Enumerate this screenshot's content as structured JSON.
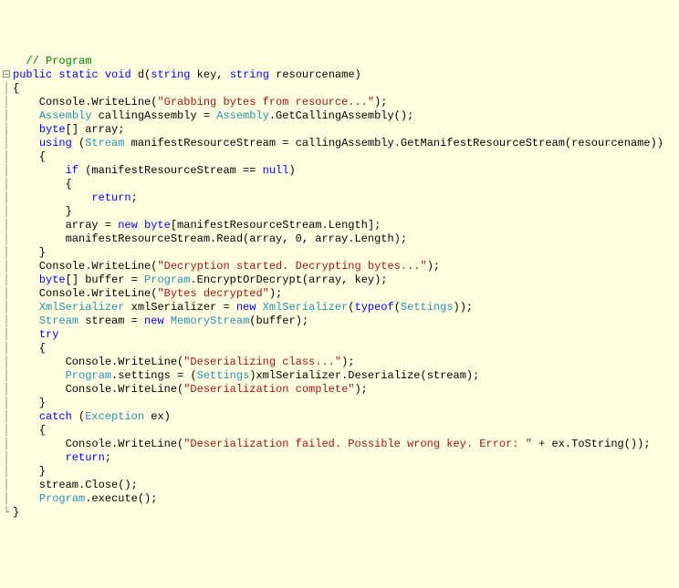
{
  "lines": [
    {
      "gutter": "",
      "tokens": [
        {
          "cls": "c-ident",
          "t": "  "
        },
        {
          "cls": "c-comment",
          "t": "// Program"
        }
      ]
    },
    {
      "gutter": "⊟",
      "tokens": [
        {
          "cls": "c-keyword",
          "t": "public"
        },
        {
          "cls": "c-ident",
          "t": " "
        },
        {
          "cls": "c-keyword",
          "t": "static"
        },
        {
          "cls": "c-ident",
          "t": " "
        },
        {
          "cls": "c-keyword",
          "t": "void"
        },
        {
          "cls": "c-ident",
          "t": " d("
        },
        {
          "cls": "c-keyword",
          "t": "string"
        },
        {
          "cls": "c-ident",
          "t": " key, "
        },
        {
          "cls": "c-keyword",
          "t": "string"
        },
        {
          "cls": "c-ident",
          "t": " resourcename)"
        }
      ]
    },
    {
      "gutter": "│",
      "tokens": [
        {
          "cls": "c-ident",
          "t": "{"
        }
      ]
    },
    {
      "gutter": "│",
      "tokens": [
        {
          "cls": "c-ident",
          "t": "    Console.WriteLine("
        },
        {
          "cls": "c-string",
          "t": "\"Grabbing bytes from resource...\""
        },
        {
          "cls": "c-ident",
          "t": ");"
        }
      ]
    },
    {
      "gutter": "│",
      "tokens": [
        {
          "cls": "c-ident",
          "t": "    "
        },
        {
          "cls": "c-type",
          "t": "Assembly"
        },
        {
          "cls": "c-ident",
          "t": " callingAssembly = "
        },
        {
          "cls": "c-type",
          "t": "Assembly"
        },
        {
          "cls": "c-ident",
          "t": ".GetCallingAssembly();"
        }
      ]
    },
    {
      "gutter": "│",
      "tokens": [
        {
          "cls": "c-ident",
          "t": "    "
        },
        {
          "cls": "c-keyword",
          "t": "byte"
        },
        {
          "cls": "c-ident",
          "t": "[] array;"
        }
      ]
    },
    {
      "gutter": "│",
      "tokens": [
        {
          "cls": "c-ident",
          "t": "    "
        },
        {
          "cls": "c-keyword",
          "t": "using"
        },
        {
          "cls": "c-ident",
          "t": " ("
        },
        {
          "cls": "c-type",
          "t": "Stream"
        },
        {
          "cls": "c-ident",
          "t": " manifestResourceStream = callingAssembly.GetManifestResourceStream(resourcename))"
        }
      ]
    },
    {
      "gutter": "│",
      "tokens": [
        {
          "cls": "c-ident",
          "t": "    {"
        }
      ]
    },
    {
      "gutter": "│",
      "tokens": [
        {
          "cls": "c-ident",
          "t": "        "
        },
        {
          "cls": "c-keyword",
          "t": "if"
        },
        {
          "cls": "c-ident",
          "t": " (manifestResourceStream == "
        },
        {
          "cls": "c-keyword",
          "t": "null"
        },
        {
          "cls": "c-ident",
          "t": ")"
        }
      ]
    },
    {
      "gutter": "│",
      "tokens": [
        {
          "cls": "c-ident",
          "t": "        {"
        }
      ]
    },
    {
      "gutter": "│",
      "tokens": [
        {
          "cls": "c-ident",
          "t": "            "
        },
        {
          "cls": "c-keyword",
          "t": "return"
        },
        {
          "cls": "c-ident",
          "t": ";"
        }
      ]
    },
    {
      "gutter": "│",
      "tokens": [
        {
          "cls": "c-ident",
          "t": "        }"
        }
      ]
    },
    {
      "gutter": "│",
      "tokens": [
        {
          "cls": "c-ident",
          "t": "        array = "
        },
        {
          "cls": "c-keyword",
          "t": "new"
        },
        {
          "cls": "c-ident",
          "t": " "
        },
        {
          "cls": "c-keyword",
          "t": "byte"
        },
        {
          "cls": "c-ident",
          "t": "[manifestResourceStream.Length];"
        }
      ]
    },
    {
      "gutter": "│",
      "tokens": [
        {
          "cls": "c-ident",
          "t": "        manifestResourceStream.Read(array, 0, array.Length);"
        }
      ]
    },
    {
      "gutter": "│",
      "tokens": [
        {
          "cls": "c-ident",
          "t": "    }"
        }
      ]
    },
    {
      "gutter": "│",
      "tokens": [
        {
          "cls": "c-ident",
          "t": "    Console.WriteLine("
        },
        {
          "cls": "c-string",
          "t": "\"Decryption started. Decrypting bytes...\""
        },
        {
          "cls": "c-ident",
          "t": ");"
        }
      ]
    },
    {
      "gutter": "│",
      "tokens": [
        {
          "cls": "c-ident",
          "t": "    "
        },
        {
          "cls": "c-keyword",
          "t": "byte"
        },
        {
          "cls": "c-ident",
          "t": "[] buffer = "
        },
        {
          "cls": "c-type",
          "t": "Program"
        },
        {
          "cls": "c-ident",
          "t": ".EncryptOrDecrypt(array, key);"
        }
      ]
    },
    {
      "gutter": "│",
      "tokens": [
        {
          "cls": "c-ident",
          "t": "    Console.WriteLine("
        },
        {
          "cls": "c-string",
          "t": "\"Bytes decrypted\""
        },
        {
          "cls": "c-ident",
          "t": ");"
        }
      ]
    },
    {
      "gutter": "│",
      "tokens": [
        {
          "cls": "c-ident",
          "t": "    "
        },
        {
          "cls": "c-type",
          "t": "XmlSerializer"
        },
        {
          "cls": "c-ident",
          "t": " xmlSerializer = "
        },
        {
          "cls": "c-keyword",
          "t": "new"
        },
        {
          "cls": "c-ident",
          "t": " "
        },
        {
          "cls": "c-type",
          "t": "XmlSerializer"
        },
        {
          "cls": "c-ident",
          "t": "("
        },
        {
          "cls": "c-keyword",
          "t": "typeof"
        },
        {
          "cls": "c-ident",
          "t": "("
        },
        {
          "cls": "c-type",
          "t": "Settings"
        },
        {
          "cls": "c-ident",
          "t": "));"
        }
      ]
    },
    {
      "gutter": "│",
      "tokens": [
        {
          "cls": "c-ident",
          "t": "    "
        },
        {
          "cls": "c-type",
          "t": "Stream"
        },
        {
          "cls": "c-ident",
          "t": " stream = "
        },
        {
          "cls": "c-keyword",
          "t": "new"
        },
        {
          "cls": "c-ident",
          "t": " "
        },
        {
          "cls": "c-type",
          "t": "MemoryStream"
        },
        {
          "cls": "c-ident",
          "t": "(buffer);"
        }
      ]
    },
    {
      "gutter": "│",
      "tokens": [
        {
          "cls": "c-ident",
          "t": "    "
        },
        {
          "cls": "c-keyword",
          "t": "try"
        }
      ]
    },
    {
      "gutter": "│",
      "tokens": [
        {
          "cls": "c-ident",
          "t": "    {"
        }
      ]
    },
    {
      "gutter": "│",
      "tokens": [
        {
          "cls": "c-ident",
          "t": "        Console.WriteLine("
        },
        {
          "cls": "c-string",
          "t": "\"Deserializing class...\""
        },
        {
          "cls": "c-ident",
          "t": ");"
        }
      ]
    },
    {
      "gutter": "│",
      "tokens": [
        {
          "cls": "c-ident",
          "t": "        "
        },
        {
          "cls": "c-type",
          "t": "Program"
        },
        {
          "cls": "c-ident",
          "t": ".settings = ("
        },
        {
          "cls": "c-type",
          "t": "Settings"
        },
        {
          "cls": "c-ident",
          "t": ")xmlSerializer.Deserialize(stream);"
        }
      ]
    },
    {
      "gutter": "│",
      "tokens": [
        {
          "cls": "c-ident",
          "t": "        Console.WriteLine("
        },
        {
          "cls": "c-string",
          "t": "\"Deserialization complete\""
        },
        {
          "cls": "c-ident",
          "t": ");"
        }
      ]
    },
    {
      "gutter": "│",
      "tokens": [
        {
          "cls": "c-ident",
          "t": "    }"
        }
      ]
    },
    {
      "gutter": "│",
      "tokens": [
        {
          "cls": "c-ident",
          "t": "    "
        },
        {
          "cls": "c-keyword",
          "t": "catch"
        },
        {
          "cls": "c-ident",
          "t": " ("
        },
        {
          "cls": "c-type",
          "t": "Exception"
        },
        {
          "cls": "c-ident",
          "t": " ex)"
        }
      ]
    },
    {
      "gutter": "│",
      "tokens": [
        {
          "cls": "c-ident",
          "t": "    {"
        }
      ]
    },
    {
      "gutter": "│",
      "tokens": [
        {
          "cls": "c-ident",
          "t": "        Console.WriteLine("
        },
        {
          "cls": "c-string",
          "t": "\"Deserialization failed. Possible wrong key. Error: \""
        },
        {
          "cls": "c-ident",
          "t": " + ex.ToString());"
        }
      ]
    },
    {
      "gutter": "│",
      "tokens": [
        {
          "cls": "c-ident",
          "t": "        "
        },
        {
          "cls": "c-keyword",
          "t": "return"
        },
        {
          "cls": "c-ident",
          "t": ";"
        }
      ]
    },
    {
      "gutter": "│",
      "tokens": [
        {
          "cls": "c-ident",
          "t": "    }"
        }
      ]
    },
    {
      "gutter": "│",
      "tokens": [
        {
          "cls": "c-ident",
          "t": "    stream.Close();"
        }
      ]
    },
    {
      "gutter": "│",
      "tokens": [
        {
          "cls": "c-ident",
          "t": "    "
        },
        {
          "cls": "c-type",
          "t": "Program"
        },
        {
          "cls": "c-ident",
          "t": ".execute();"
        }
      ]
    },
    {
      "gutter": "└",
      "tokens": [
        {
          "cls": "c-ident",
          "t": "}"
        }
      ]
    }
  ]
}
